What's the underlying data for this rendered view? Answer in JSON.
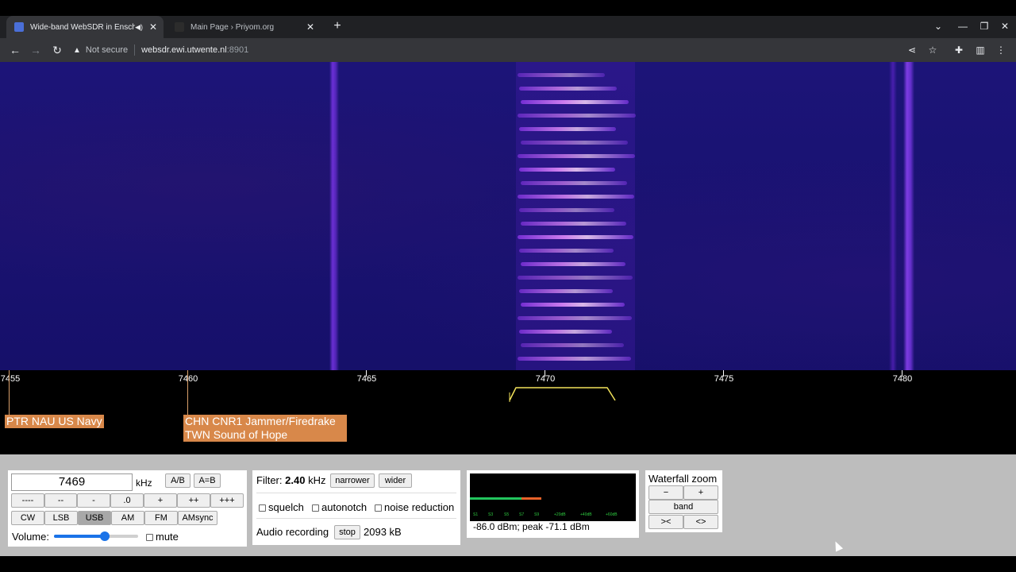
{
  "browser": {
    "tabs": [
      {
        "title": "Wide-band WebSDR in Ensch",
        "active": true
      },
      {
        "title": "Main Page › Priyom.org",
        "active": false
      }
    ],
    "address": {
      "security": "Not secure",
      "host": "websdr.ewi.utwente.nl",
      "port": ":8901"
    }
  },
  "scale": {
    "ticks": [
      "7455",
      "7460",
      "7465",
      "7470",
      "7475",
      "7480"
    ]
  },
  "stations": [
    {
      "text": "PTR NAU US Navy"
    },
    {
      "line1": "CHN CNR1 Jammer/Firedrake",
      "line2": "TWN Sound of Hope"
    }
  ],
  "tuning": {
    "frequency": "7469",
    "unit": "kHz",
    "ab": "A/B",
    "a_eq_b": "A=B",
    "step_buttons": [
      "----",
      "--",
      "-",
      ".0",
      "+",
      "++",
      "+++"
    ],
    "modes": [
      "CW",
      "LSB",
      "USB",
      "AM",
      "FM",
      "AMsync"
    ],
    "selected_mode": "USB",
    "volume_label": "Volume:",
    "volume_level": 0.6,
    "mute_label": "mute"
  },
  "filter": {
    "label": "Filter:",
    "value": "2.40",
    "unit": "kHz",
    "narrower": "narrower",
    "wider": "wider",
    "squelch": "squelch",
    "autonotch": "autonotch",
    "noise_reduction": "noise reduction",
    "recording_label": "Audio recording",
    "stop": "stop",
    "recorded_size": "2093 kB"
  },
  "smeter": {
    "readout": "-86.0 dBm; peak  -71.1 dBm",
    "scale_labels": [
      "S1",
      "S3",
      "S5",
      "S7",
      "S9",
      "+20dB",
      "+40dB",
      "+60dB"
    ],
    "level_fraction": 0.31,
    "peak_fraction": 0.43
  },
  "zoom": {
    "title": "Waterfall zoom",
    "minus": "−",
    "plus": "+",
    "band": "band",
    "narrow": "><",
    "widen": "<>"
  }
}
